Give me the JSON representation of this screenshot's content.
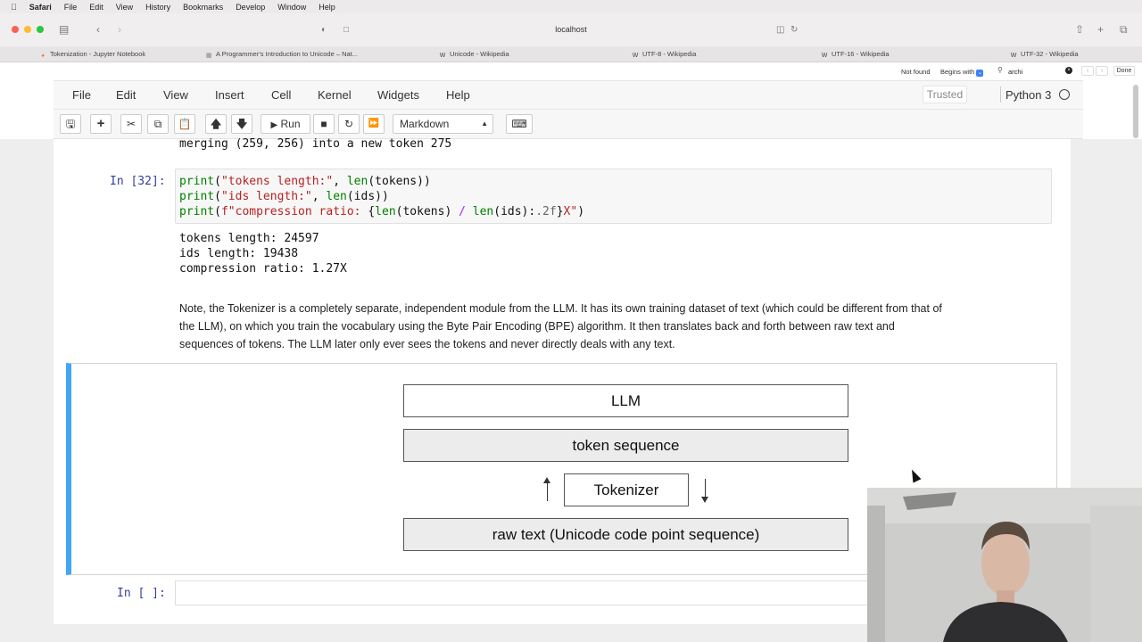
{
  "macos_menubar": {
    "app": "Safari",
    "items": [
      "File",
      "Edit",
      "View",
      "History",
      "Bookmarks",
      "Develop",
      "Window",
      "Help"
    ]
  },
  "browser": {
    "address": "localhost",
    "tabs": [
      {
        "label": "Tokenization - Jupyter Notebook",
        "icon": "jupyter-icon"
      },
      {
        "label": "A Programmer's Introduction to Unicode – Nat...",
        "icon": "page-icon"
      },
      {
        "label": "Unicode - Wikipedia",
        "icon": "wikipedia-icon"
      },
      {
        "label": "UTF-8 - Wikipedia",
        "icon": "wikipedia-icon"
      },
      {
        "label": "UTF-16 - Wikipedia",
        "icon": "wikipedia-icon"
      },
      {
        "label": "UTF-32 - Wikipedia",
        "icon": "wikipedia-icon"
      }
    ],
    "findbar": {
      "status": "Not found",
      "mode": "Begins with",
      "query": "archi",
      "done": "Done"
    }
  },
  "jupyter": {
    "menu": [
      "File",
      "Edit",
      "View",
      "Insert",
      "Cell",
      "Kernel",
      "Widgets",
      "Help"
    ],
    "trusted": "Trusted",
    "kernel": "Python 3",
    "toolbar": {
      "run_label": "Run",
      "cell_type": "Markdown"
    }
  },
  "notebook": {
    "prev_output": "merging (259, 256) into a new token 275",
    "cell32": {
      "prompt": "In [32]:",
      "line1": {
        "fn": "print",
        "p1": "(",
        "s": "\"tokens length:\"",
        "p2": ", ",
        "fn2": "len",
        "p3": "(tokens))"
      },
      "line2": {
        "fn": "print",
        "p1": "(",
        "s": "\"ids length:\"",
        "p2": ", ",
        "fn2": "len",
        "p3": "(ids))"
      },
      "line3": {
        "fn": "print",
        "p1": "(",
        "s1": "f\"compression ratio: ",
        "e1": "{",
        "fn2": "len",
        "e2": "(tokens) ",
        "op": "/",
        "sp": " ",
        "fn3": "len",
        "e3": "(ids):",
        "fmt": ".2f",
        "e4": "}",
        "s2": "X\"",
        "p3": ")"
      },
      "outputs": [
        "tokens length: 24597",
        "ids length: 19438",
        "compression ratio: 1.27X"
      ]
    },
    "note": [
      "Note, the Tokenizer is a completely separate, independent module from the LLM. It has its own training dataset of text (which could be different from that of",
      "the LLM), on which you train the vocabulary using the Byte Pair Encoding (BPE) algorithm. It then translates back and forth between raw text and",
      "sequences of tokens. The LLM later only ever sees the tokens and never directly deals with any text."
    ],
    "diagram": {
      "llm": "LLM",
      "token_sequence": "token sequence",
      "tokenizer": "Tokenizer",
      "raw_text": "raw text (Unicode code point sequence)"
    },
    "empty_prompt": "In [ ]:"
  }
}
